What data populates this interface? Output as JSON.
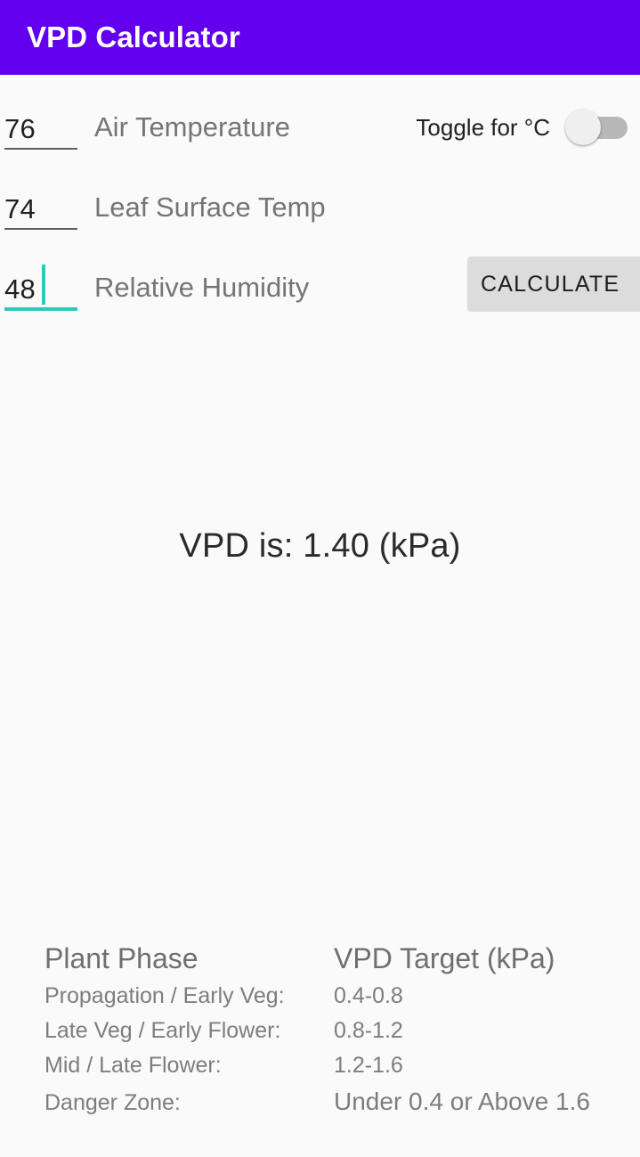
{
  "appbar": {
    "title": "VPD Calculator",
    "background_color": "#6200EE",
    "title_color": "#FFFFFF"
  },
  "theme": {
    "background_color": "#FAFAFA",
    "accent_color": "#2CC9BD",
    "label_color": "#757575",
    "button_color": "#DCDCDC"
  },
  "form": {
    "fields": [
      {
        "name": "air-temperature",
        "value": "76",
        "label": "Air Temperature",
        "focused": false
      },
      {
        "name": "leaf-surface-temp",
        "value": "74",
        "label": "Leaf Surface Temp",
        "focused": false
      },
      {
        "name": "relative-humidity",
        "value": "48",
        "label": "Relative Humidity",
        "focused": true
      }
    ],
    "toggle": {
      "label": "Toggle for °C",
      "state": "off"
    },
    "calculate_label": "CALCULATE"
  },
  "result": {
    "text": "VPD is: 1.40 (kPa)",
    "value": "1.40",
    "unit": "kPa"
  },
  "reference_table": {
    "headers": {
      "phase": "Plant Phase",
      "target": "VPD Target (kPa)"
    },
    "rows": [
      {
        "phase": "Propagation / Early Veg:",
        "target": "0.4-0.8"
      },
      {
        "phase": "Late Veg / Early Flower:",
        "target": "0.8-1.2"
      },
      {
        "phase": "Mid / Late Flower:",
        "target": "1.2-1.6"
      },
      {
        "phase": "Danger Zone:",
        "target": "Under 0.4 or Above 1.6"
      }
    ]
  }
}
